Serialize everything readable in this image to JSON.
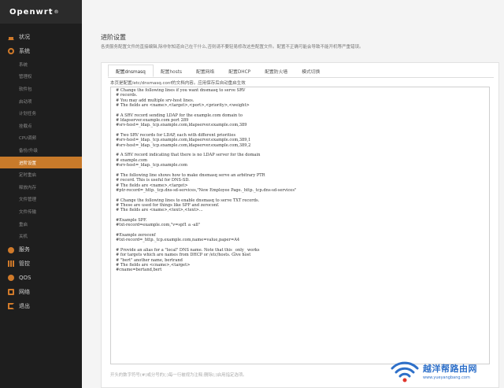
{
  "brand": {
    "name": "Openwrt",
    "mark": "®"
  },
  "sidebar": {
    "items": [
      {
        "label": "状况",
        "icon": "home-icon"
      },
      {
        "label": "系统",
        "icon": "gear-icon"
      }
    ],
    "submenu": [
      {
        "label": "系统"
      },
      {
        "label": "管理权"
      },
      {
        "label": "软件包"
      },
      {
        "label": "启动项"
      },
      {
        "label": "计划任务"
      },
      {
        "label": "挂载点"
      },
      {
        "label": "CPU调频"
      },
      {
        "label": "备份/升级"
      },
      {
        "label": "进阶设置",
        "active": true
      },
      {
        "label": "定时重启"
      },
      {
        "label": "释放内存"
      },
      {
        "label": "文件管理"
      },
      {
        "label": "文件传输"
      },
      {
        "label": "重启"
      },
      {
        "label": "关机"
      }
    ],
    "bottom_items": [
      {
        "label": "服务",
        "icon": "cloud-icon"
      },
      {
        "label": "管控",
        "icon": "control-icon"
      },
      {
        "label": "QOS",
        "icon": "qos-icon"
      },
      {
        "label": "网络",
        "icon": "network-icon"
      },
      {
        "label": "退出",
        "icon": "logout-icon"
      }
    ]
  },
  "main": {
    "title": "进阶设置",
    "description": "各类服务配置文件的直接编辑,除非你知道自己在干什么,否则请不要轻易修改这些配置文件。配置不正确可能会导致不能开机等严重错误。",
    "tabs": [
      {
        "label": "配置dnsmasq",
        "active": true
      },
      {
        "label": "配置hosts"
      },
      {
        "label": "配置网络"
      },
      {
        "label": "配置DHCP"
      },
      {
        "label": "配置防火墙"
      },
      {
        "label": "模式切换"
      }
    ],
    "section_description": "本页是配置/etc/dnsmasq.conf的文档内容。应用保存后自动重启生效",
    "editor_content": "# Change the following lines if you want dnsmasq to serve SRV\n# records.\n# You may add multiple srv-host lines.\n# The fields are <name>,<target>,<port>,<priority>,<weight>\n\n# A SRV record sending LDAP for the example.com domain to\n# ldapserver.example.com port 289\n#srv-host=_ldap._tcp.example.com,ldapserver.example.com,389\n\n# Two SRV records for LDAP, each with different priorities\n#srv-host=_ldap._tcp.example.com,ldapserver.example.com,389,1\n#srv-host=_ldap._tcp.example.com,ldapserver.example.com,389,2\n\n# A SRV record indicating that there is no LDAP server for the domain\n# example.com\n#srv-host=_ldap._tcp.example.com\n\n# The following line shows how to make dnsmasq serve an arbitrary PTR\n# record. This is useful for DNS-SD.\n# The fields are <name>,<target>\n#ptr-record=_http._tcp.dns-sd-services,\"New Employee Page._http._tcp.dns-sd-services\"\n\n# Change the following lines to enable dnsmasq to serve TXT records.\n# These are used for things like SPF and zeroconf.\n# The fields are <name>,<text>,<text>...\n\n#Example SPF.\n#txt-record=example.com,\"v=spf1 a -all\"\n\n#Example zeroconf\n#txt-record=_http._tcp.example.com,name=value,paper=A4\n\n# Provide an alias for a \"local\" DNS name. Note that this _only_ works\n# for targets which are names from DHCP or /etc/hosts. Give host\n# \"bert\" another name, bertrand\n# The fields are <cname>,<target>\n#cname=bertand,bert",
    "bottom_hint": "开头的数字符号(#)或分号的(;)每一行被视为注释;删除(;)启用指定选项。"
  },
  "watermark": {
    "name": "越洋帮路由网",
    "url": "www.yueyangbang.com"
  },
  "colors": {
    "sidebar_bg": "#1e1e1e",
    "accent": "#c87a2a",
    "watermark": "#2e70c9"
  }
}
